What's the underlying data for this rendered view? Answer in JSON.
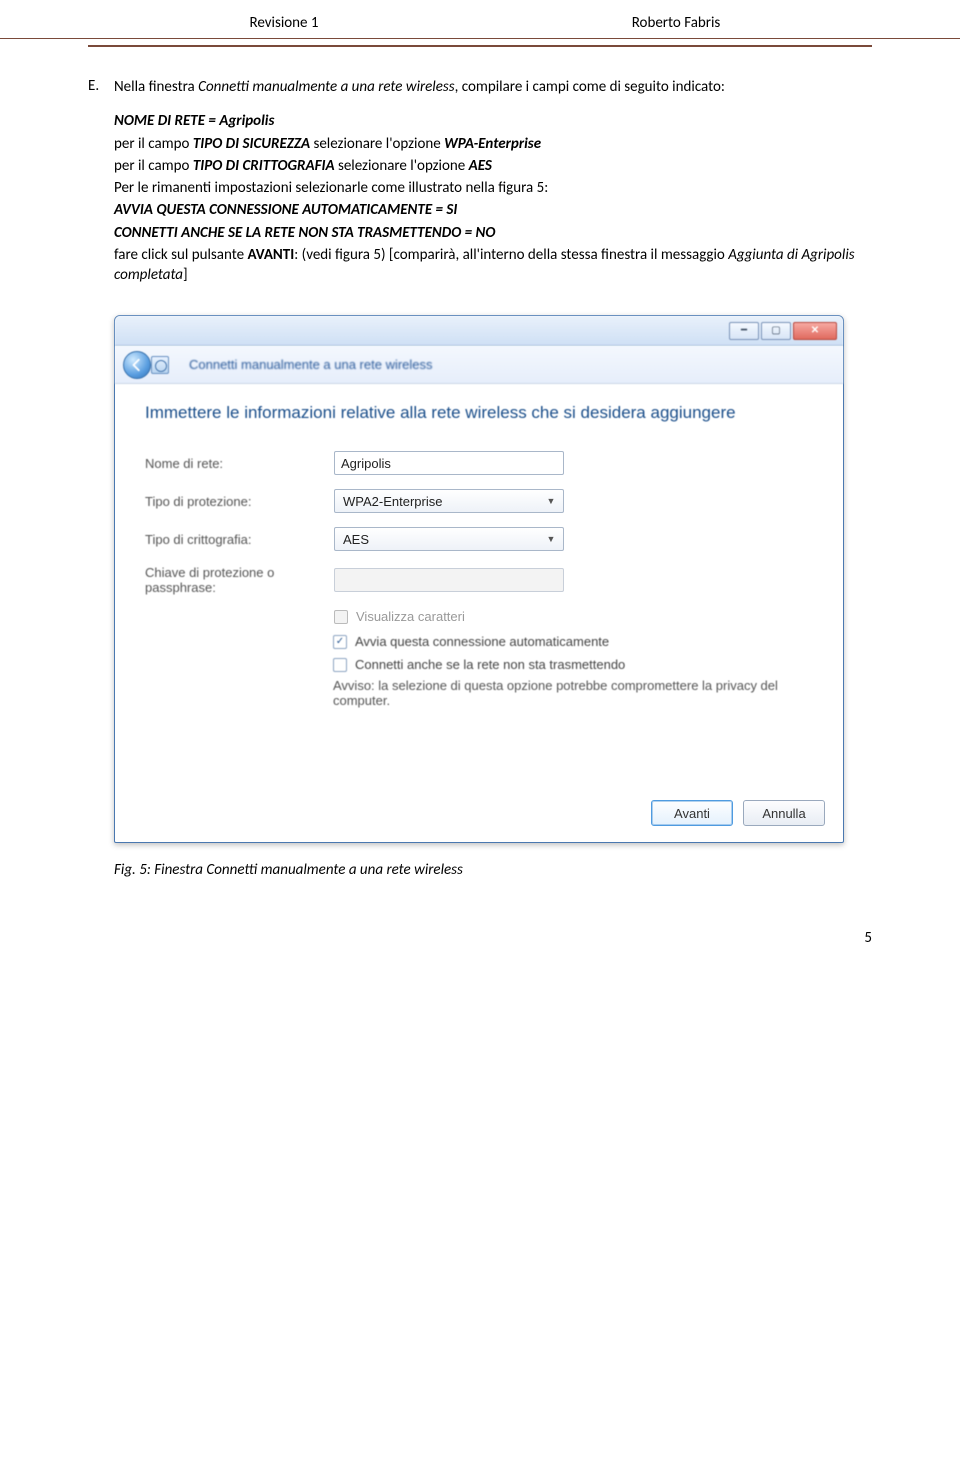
{
  "header": {
    "left": "Revisione 1",
    "right": "Roberto Fabris"
  },
  "step_letter": "E.",
  "intro_a": "Nella finestra ",
  "intro_b": "Connetti manualmente a una rete wireless",
  "intro_c": ", compilare i campi come di seguito indicato:",
  "bullets": {
    "nome_label": "NOME DI RETE = Agripolis",
    "campo_tipo_pre": "per il campo ",
    "tipo_sicurezza": "TIPO DI SICUREZZA",
    "sel_wpa": " selezionare l'opzione ",
    "wpa_val": "WPA-Enterprise",
    "tipo_critto": "TIPO DI CRITTOGRAFIA",
    "sel_aes": " selezionare l'opzione ",
    "aes_val": "AES",
    "rimanenti": "Per le rimanenti impostazioni selezionarle come illustrato nella figura 5:",
    "avvia": "AVVIA QUESTA CONNESSIONE AUTOMATICAMENTE = SI",
    "connetti": "CONNETTI ANCHE SE LA RETE NON STA TRASMETTENDO = NO",
    "fare_pre": "fare click sul pulsante ",
    "fare_btn": "AVANTI",
    "fare_mid": ": (vedi figura 5) [comparirà, all'interno della stessa finestra il messaggio ",
    "fare_em": "Aggiunta di Agripolis completata",
    "fare_end": "]"
  },
  "window": {
    "nav_title": "Connetti manualmente a una rete wireless",
    "heading": "Immettere le informazioni relative alla rete wireless che si desidera aggiungere",
    "labels": {
      "nome": "Nome di rete:",
      "protezione": "Tipo di protezione:",
      "critto": "Tipo di crittografia:",
      "chiave": "Chiave di protezione o\npassphrase:"
    },
    "values": {
      "nome": "Agripolis",
      "protezione": "WPA2-Enterprise",
      "critto": "AES",
      "chiave": ""
    },
    "visualizza": "Visualizza caratteri",
    "chk_avvia": "Avvia questa connessione automaticamente",
    "chk_connetti": "Connetti anche se la rete non sta trasmettendo",
    "avviso": "Avviso: la selezione di questa opzione potrebbe compromettere la privacy del computer.",
    "btn_next": "Avanti",
    "btn_cancel": "Annulla"
  },
  "fig_caption": "Fig. 5: Finestra Connetti manualmente a una rete wireless",
  "page_number": "5"
}
